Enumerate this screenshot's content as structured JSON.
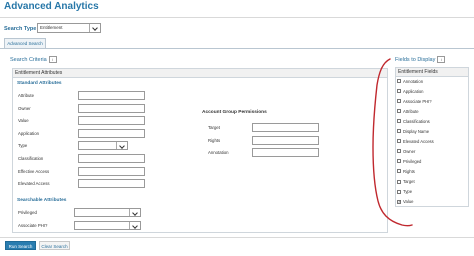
{
  "app": {
    "title": "Advanced Analytics"
  },
  "search_type": {
    "label": "Search Type",
    "value": "Entitlement"
  },
  "tab": {
    "label": "Advanced Search"
  },
  "criteria": {
    "title": "Search Criteria",
    "panel_title": "Entitlement Attributes",
    "standard": {
      "title": "Standard Attributes",
      "fields": [
        {
          "label": "Attribute",
          "kind": "text"
        },
        {
          "label": "Owner",
          "kind": "text"
        },
        {
          "label": "Value",
          "kind": "text"
        },
        {
          "label": "Application",
          "kind": "text"
        },
        {
          "label": "Type",
          "kind": "select"
        },
        {
          "label": "Classification",
          "kind": "text"
        },
        {
          "label": "Effective Access",
          "kind": "text"
        },
        {
          "label": "Elevated Access",
          "kind": "text"
        }
      ]
    },
    "account_group": {
      "title": "Account Group Permissions",
      "fields": [
        {
          "label": "Target"
        },
        {
          "label": "Rights"
        },
        {
          "label": "Annotation"
        }
      ]
    },
    "searchable": {
      "title": "Searchable Attributes",
      "fields": [
        {
          "label": "Privileged"
        },
        {
          "label": "Associate PHI?"
        }
      ]
    }
  },
  "fields_display": {
    "title": "Fields to Display",
    "panel_title": "Entitlement Fields",
    "items": [
      {
        "label": "Annotation",
        "checked": false
      },
      {
        "label": "Application",
        "checked": false
      },
      {
        "label": "Associate PHI?",
        "checked": false
      },
      {
        "label": "Attribute",
        "checked": false
      },
      {
        "label": "Classifications",
        "checked": false
      },
      {
        "label": "Display Name",
        "checked": false
      },
      {
        "label": "Elevated Access",
        "checked": false
      },
      {
        "label": "Owner",
        "checked": false
      },
      {
        "label": "Privileged",
        "checked": false
      },
      {
        "label": "Rights",
        "checked": false
      },
      {
        "label": "Target",
        "checked": false
      },
      {
        "label": "Type",
        "checked": false
      },
      {
        "label": "Value",
        "checked": true
      }
    ]
  },
  "buttons": {
    "run": "Run Search",
    "clear": "Clear Search"
  },
  "annotation": {
    "color": "#c0282e"
  }
}
